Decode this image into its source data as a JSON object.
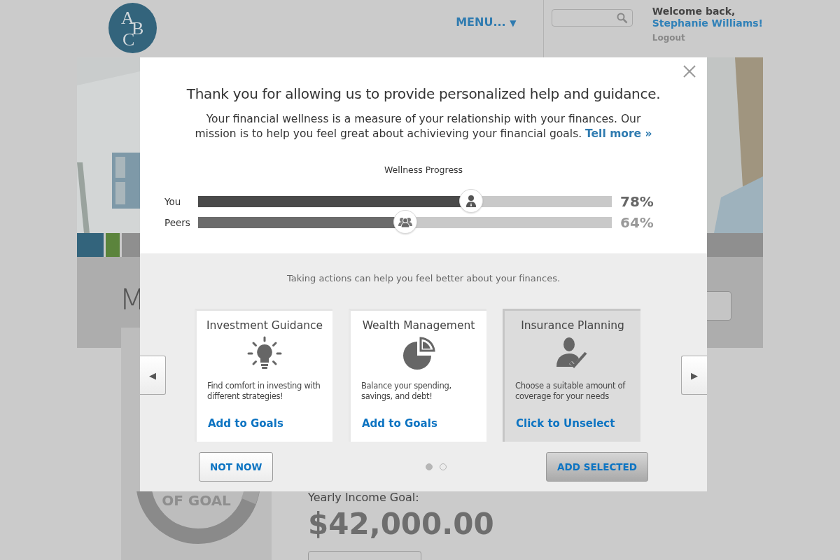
{
  "header": {
    "logo_letters": [
      "A",
      "B",
      "C"
    ],
    "menu": {
      "label": "MENU...",
      "caret": "▼"
    },
    "welcome": "Welcome back,",
    "user": "Stephanie Williams!",
    "logout": "Logout"
  },
  "background": {
    "section_heading": "M",
    "goal_label": "OF GOAL",
    "income_label": "Yearly Income Goal:",
    "income_value": "$42,000.00"
  },
  "dialog": {
    "title": "Thank you for allowing us to provide personalized help and guidance.",
    "intro": "Your financial wellness is a measure of your relationship with your finances. Our mission is to help you feel great about achivieving your financial goals.",
    "intro_link": "Tell more »",
    "progress": {
      "title": "Wellness Progress",
      "rows": [
        {
          "label": "You",
          "level": 0.66,
          "reading": "78%"
        },
        {
          "label": "Peers",
          "level": 0.5,
          "reading": "64%"
        }
      ]
    },
    "caption": "Taking actions can help you feel better about your finances.",
    "prev": "◀",
    "next": "▶",
    "cards": [
      {
        "title": "Investment Guidance",
        "description": "Find comfort in investing with different strategies!",
        "action": "Add to Goals",
        "selected": false
      },
      {
        "title": "Wealth Management",
        "description": "Balance your spending, savings, and debt!",
        "action": "Add to Goals",
        "selected": false
      },
      {
        "title": "Insurance Planning",
        "description": "Choose a suitable amount of coverage for your needs",
        "action": "Click to Unselect",
        "selected": true
      }
    ],
    "pages": [
      {
        "selected": true
      },
      {
        "selected": false
      }
    ],
    "buttons": {
      "dismiss": "NOT NOW",
      "confirm": "ADD SELECTED"
    }
  }
}
